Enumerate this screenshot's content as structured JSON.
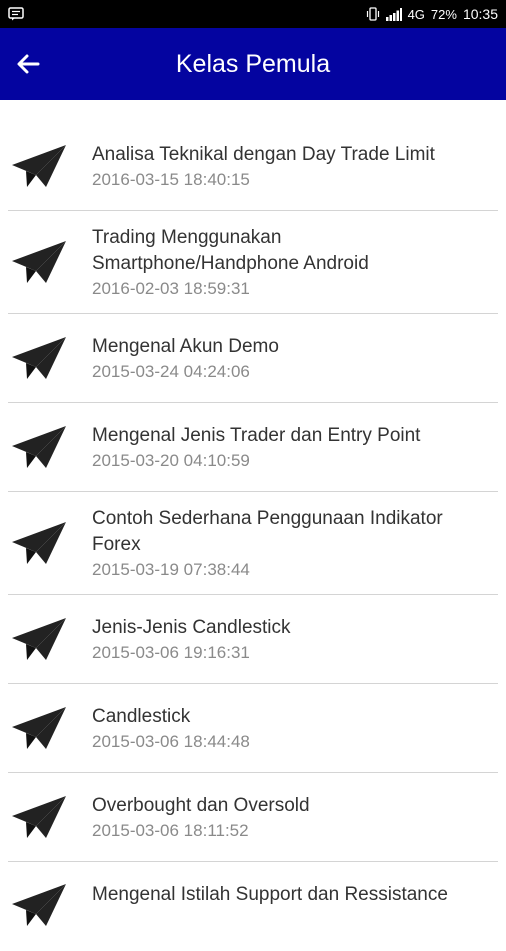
{
  "status_bar": {
    "network": "4G",
    "battery": "72%",
    "time": "10:35"
  },
  "app_bar": {
    "title": "Kelas Pemula",
    "back_icon": "arrow-left-icon",
    "color": "#0404a0"
  },
  "items": [
    {
      "title": "Analisa Teknikal dengan Day Trade Limit",
      "date": "2016-03-15 18:40:15"
    },
    {
      "title": "Trading Menggunakan Smartphone/Handphone Android",
      "date": "2016-02-03 18:59:31"
    },
    {
      "title": "Mengenal Akun Demo",
      "date": "2015-03-24 04:24:06"
    },
    {
      "title": "Mengenal Jenis Trader dan Entry Point",
      "date": "2015-03-20 04:10:59"
    },
    {
      "title": "Contoh Sederhana Penggunaan Indikator Forex",
      "date": "2015-03-19 07:38:44"
    },
    {
      "title": "Jenis-Jenis Candlestick",
      "date": "2015-03-06 19:16:31"
    },
    {
      "title": "Candlestick",
      "date": "2015-03-06 18:44:48"
    },
    {
      "title": "Overbought dan Oversold",
      "date": "2015-03-06 18:11:52"
    },
    {
      "title": "Mengenal Istilah Support dan Ressistance",
      "date": ""
    }
  ]
}
